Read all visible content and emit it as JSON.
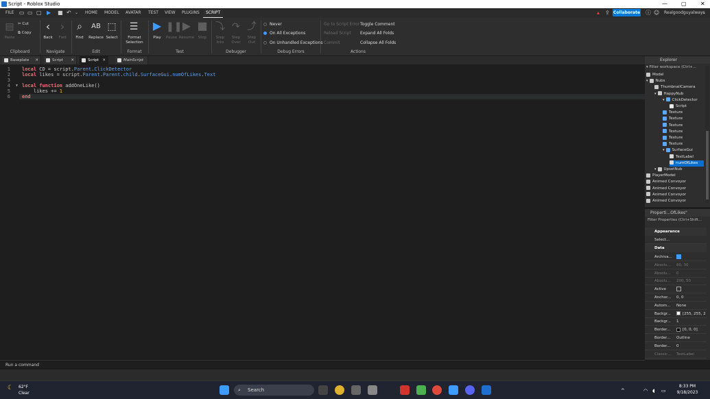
{
  "window": {
    "title": "Script - Roblox Studio",
    "controls": [
      "—",
      "▢",
      "✕"
    ]
  },
  "menu": {
    "file": "FILE",
    "tabs": [
      "HOME",
      "MODEL",
      "AVATAR",
      "TEST",
      "VIEW",
      "PLUGINS",
      "SCRIPT"
    ],
    "active_tab": "SCRIPT",
    "collaborate": "Collaborate",
    "username": "Realgoodguyalways"
  },
  "ribbon": {
    "clipboard": {
      "paste": "Paste",
      "cut": "Cut",
      "copy": "Copy",
      "group": "Clipboard"
    },
    "navigate": {
      "back": "Back",
      "forward": "Fwd",
      "group": "Navigate"
    },
    "edit": {
      "find": "Find",
      "replace": "Replace",
      "select": "Select",
      "group": "Edit"
    },
    "format": {
      "format_selection": "Format Selection",
      "group": "Format"
    },
    "test": {
      "play": "Play",
      "pause": "Pause",
      "resume": "Resume",
      "stop": "Stop",
      "group": "Test"
    },
    "debugger": {
      "step_into": "Step Into",
      "step_over": "Step Over",
      "step_out": "Step Out",
      "group": "Debugger"
    },
    "debug_errors": {
      "never": "Never",
      "on_all": "On All Exceptions",
      "on_unhandled": "On Unhandled Exceptions",
      "group": "Debug Errors"
    },
    "actions": {
      "go_to_error": "Go to Script Error",
      "reload_script": "Reload Script",
      "commit": "Commit",
      "toggle_comment": "Toggle Comment",
      "expand_all": "Expand All Folds",
      "collapse_all": "Collapse All Folds",
      "group": "Actions"
    }
  },
  "tabs": [
    {
      "label": "Baseplate",
      "active": false,
      "italic": false
    },
    {
      "label": "Script",
      "active": false,
      "italic": false
    },
    {
      "label": "Script",
      "active": true,
      "italic": false
    },
    {
      "label": "MainScript",
      "active": false,
      "italic": true
    }
  ],
  "editor": {
    "line_numbers": [
      "1",
      "2",
      "3",
      "4",
      "5",
      "6"
    ],
    "line1": {
      "kw": "local",
      "rest": " CD = script.",
      "p1": "Parent",
      "dot": ".",
      "p2": "ClickDetector"
    },
    "line2": {
      "kw": "local",
      "rest": " likes = script.",
      "p1": "Parent",
      "d1": ".",
      "p2": "Parent",
      "d2": ".",
      "p3": "child",
      "d3": ".",
      "p4": "SurfaceGui",
      "d4": ".",
      "p5": "numOfLikes",
      "d5": ".",
      "p6": "Text"
    },
    "line4": {
      "kw1": "local",
      "kw2": "function",
      "rest": " addOneLike()"
    },
    "line5": {
      "rest": "    likes += ",
      "num": "1"
    },
    "line6": {
      "kw": "end"
    }
  },
  "command_bar": {
    "placeholder": "Run a command"
  },
  "explorer": {
    "title": "Explorer",
    "filter": "Filter workspace (Ctrl+...",
    "items": [
      {
        "label": "Model",
        "icon_color": "#c9c9c9"
      },
      {
        "label": "Nubs",
        "icon_color": "#c9c9c9"
      },
      {
        "label": "ThumbnailCamera",
        "icon_color": "#c9c9c9"
      },
      {
        "label": "HappyNub",
        "icon_color": "#c9c9c9"
      },
      {
        "label": "ClickDetector",
        "icon_color": "#5aa8ff"
      },
      {
        "label": "Script",
        "icon_color": "#e8e8e8"
      },
      {
        "label": "Texture",
        "icon_color": "#5aa8ff"
      },
      {
        "label": "Texture",
        "icon_color": "#5aa8ff"
      },
      {
        "label": "Texture",
        "icon_color": "#5aa8ff"
      },
      {
        "label": "Texture",
        "icon_color": "#5aa8ff"
      },
      {
        "label": "Texture",
        "icon_color": "#5aa8ff"
      },
      {
        "label": "Texture",
        "icon_color": "#5aa8ff"
      },
      {
        "label": "SurfaceGui",
        "icon_color": "#5aa8ff"
      },
      {
        "label": "TextLabel",
        "icon_color": "#d8d8d8"
      },
      {
        "label": "numOfLikes",
        "icon_color": "#d8d8d8"
      },
      {
        "label": "UpsetNub",
        "icon_color": "#c9c9c9"
      },
      {
        "label": "PlayerModel",
        "icon_color": "#c9c9c9"
      },
      {
        "label": "Animed Convoyor",
        "icon_color": "#c9c9c9"
      },
      {
        "label": "Animed Convoyor",
        "icon_color": "#c9c9c9"
      },
      {
        "label": "Animed Convoyor",
        "icon_color": "#c9c9c9"
      },
      {
        "label": "Animed Convoyor",
        "icon_color": "#c9c9c9"
      }
    ],
    "selected": "numOfLikes"
  },
  "properties": {
    "title": "Properti...OfLikes\"",
    "filter": "Filter Properties (Ctrl+Shift...",
    "sections": {
      "appearance": "Appearance",
      "data": "Data"
    },
    "select_label": "Select...",
    "rows": [
      {
        "name": "Archiva...",
        "value": "",
        "checked": true,
        "dim": false
      },
      {
        "name": "Absolu...",
        "value": "80, 30",
        "dim": true
      },
      {
        "name": "Absolu...",
        "value": "0",
        "dim": true
      },
      {
        "name": "Absolu...",
        "value": "200, 50",
        "dim": true
      },
      {
        "name": "Active",
        "value": "",
        "checked": false,
        "dim": false
      },
      {
        "name": "Anchor...",
        "value": "0, 0",
        "dim": false
      },
      {
        "name": "Autom...",
        "value": "None",
        "dim": false
      },
      {
        "name": "Backgr...",
        "value": "[255, 255, 2",
        "swatch": "#ffffff",
        "dim": false
      },
      {
        "name": "Backgr...",
        "value": "1",
        "dim": false
      },
      {
        "name": "Border...",
        "value": "[0, 0, 0]",
        "swatch": "#000000",
        "dim": false
      },
      {
        "name": "Border...",
        "value": "Outline",
        "dim": false
      },
      {
        "name": "Border...",
        "value": "0",
        "dim": false
      },
      {
        "name": "Classic...",
        "value": "TextLabel",
        "dim": true
      }
    ]
  },
  "taskbar": {
    "weather_temp": "62°F",
    "weather_desc": "Clear",
    "search": "Search",
    "time": "8:33 PM",
    "date": "9/18/2023"
  },
  "colors": {
    "accent": "#0078d7",
    "selection": "#0a6dd0",
    "keyword": "#f86d7c",
    "property": "#61a1f1",
    "number": "#ffc600"
  }
}
